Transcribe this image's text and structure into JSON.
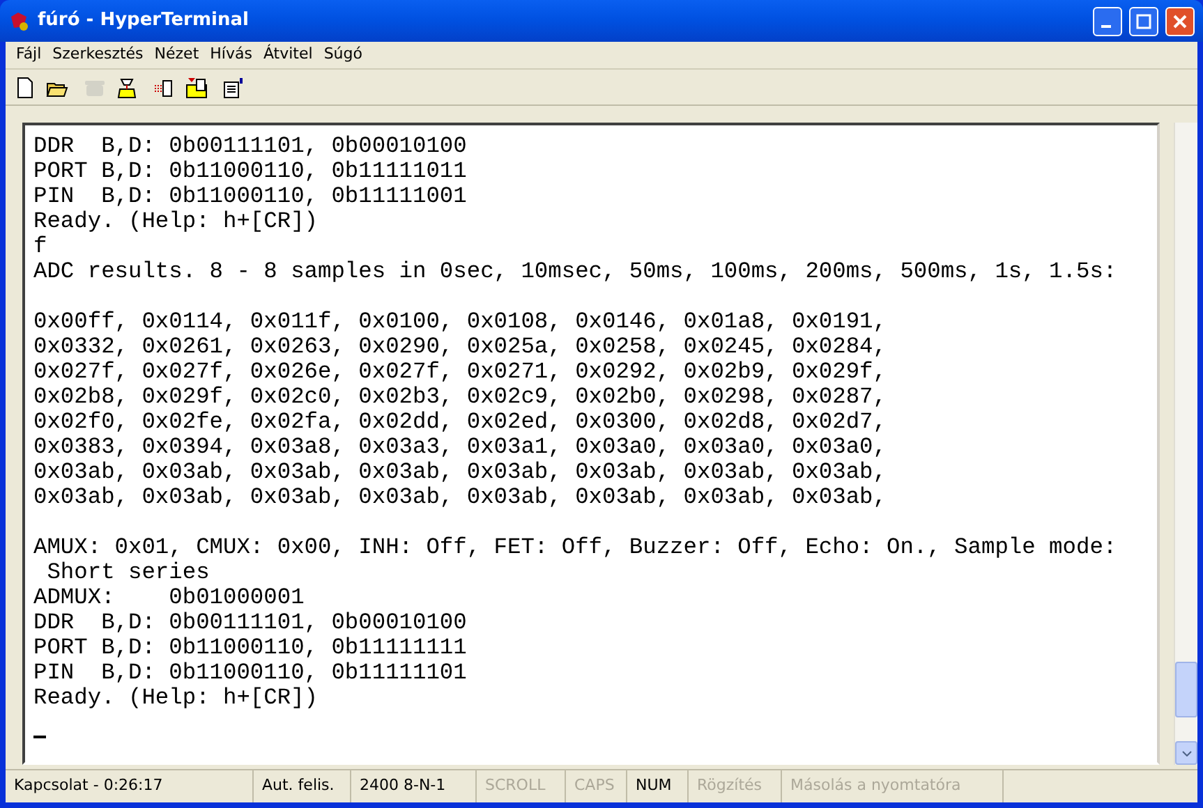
{
  "window": {
    "title": "fúró - HyperTerminal"
  },
  "menu": [
    "Fájl",
    "Szerkesztés",
    "Nézet",
    "Hívás",
    "Átvitel",
    "Súgó"
  ],
  "toolbar": [
    {
      "kind": "new",
      "disabled": false
    },
    {
      "kind": "open",
      "disabled": false
    },
    {
      "kind": "dial",
      "disabled": true
    },
    {
      "kind": "hangup",
      "disabled": false
    },
    {
      "kind": "send",
      "disabled": false
    },
    {
      "kind": "receive",
      "disabled": false
    },
    {
      "kind": "properties",
      "disabled": false
    }
  ],
  "terminal": {
    "blocks": [
      [
        "DDR  B,D: 0b00111101, 0b00010100",
        "PORT B,D: 0b11000110, 0b11111011",
        "PIN  B,D: 0b11000110, 0b11111001",
        "Ready. (Help: h+[CR])",
        "f",
        "ADC results. 8 - 8 samples in 0sec, 10msec, 50ms, 100ms, 200ms, 500ms, 1s, 1.5s:"
      ],
      [
        "0x00ff, 0x0114, 0x011f, 0x0100, 0x0108, 0x0146, 0x01a8, 0x0191,",
        "0x0332, 0x0261, 0x0263, 0x0290, 0x025a, 0x0258, 0x0245, 0x0284,",
        "0x027f, 0x027f, 0x026e, 0x027f, 0x0271, 0x0292, 0x02b9, 0x029f,",
        "0x02b8, 0x029f, 0x02c0, 0x02b3, 0x02c9, 0x02b0, 0x0298, 0x0287,",
        "0x02f0, 0x02fe, 0x02fa, 0x02dd, 0x02ed, 0x0300, 0x02d8, 0x02d7,",
        "0x0383, 0x0394, 0x03a8, 0x03a3, 0x03a1, 0x03a0, 0x03a0, 0x03a0,",
        "0x03ab, 0x03ab, 0x03ab, 0x03ab, 0x03ab, 0x03ab, 0x03ab, 0x03ab,",
        "0x03ab, 0x03ab, 0x03ab, 0x03ab, 0x03ab, 0x03ab, 0x03ab, 0x03ab,"
      ],
      [
        "AMUX: 0x01, CMUX: 0x00, INH: Off, FET: Off, Buzzer: Off, Echo: On., Sample mode:",
        " Short series",
        "ADMUX:    0b01000001",
        "DDR  B,D: 0b00111101, 0b00010100",
        "PORT B,D: 0b11000110, 0b11111111",
        "PIN  B,D: 0b11000110, 0b11111101",
        "Ready. (Help: h+[CR])"
      ]
    ],
    "cursor": true
  },
  "status_bar": [
    {
      "text": "Kapcsolat - 0:26:17",
      "disabled": false
    },
    {
      "text": "Aut. felis.",
      "disabled": false
    },
    {
      "text": "2400 8-N-1",
      "disabled": false
    },
    {
      "text": "SCROLL",
      "disabled": true
    },
    {
      "text": "CAPS",
      "disabled": true
    },
    {
      "text": "NUM",
      "disabled": false
    },
    {
      "text": "Rögzítés",
      "disabled": true
    },
    {
      "text": "Másolás a nyomtatóra",
      "disabled": true
    }
  ]
}
